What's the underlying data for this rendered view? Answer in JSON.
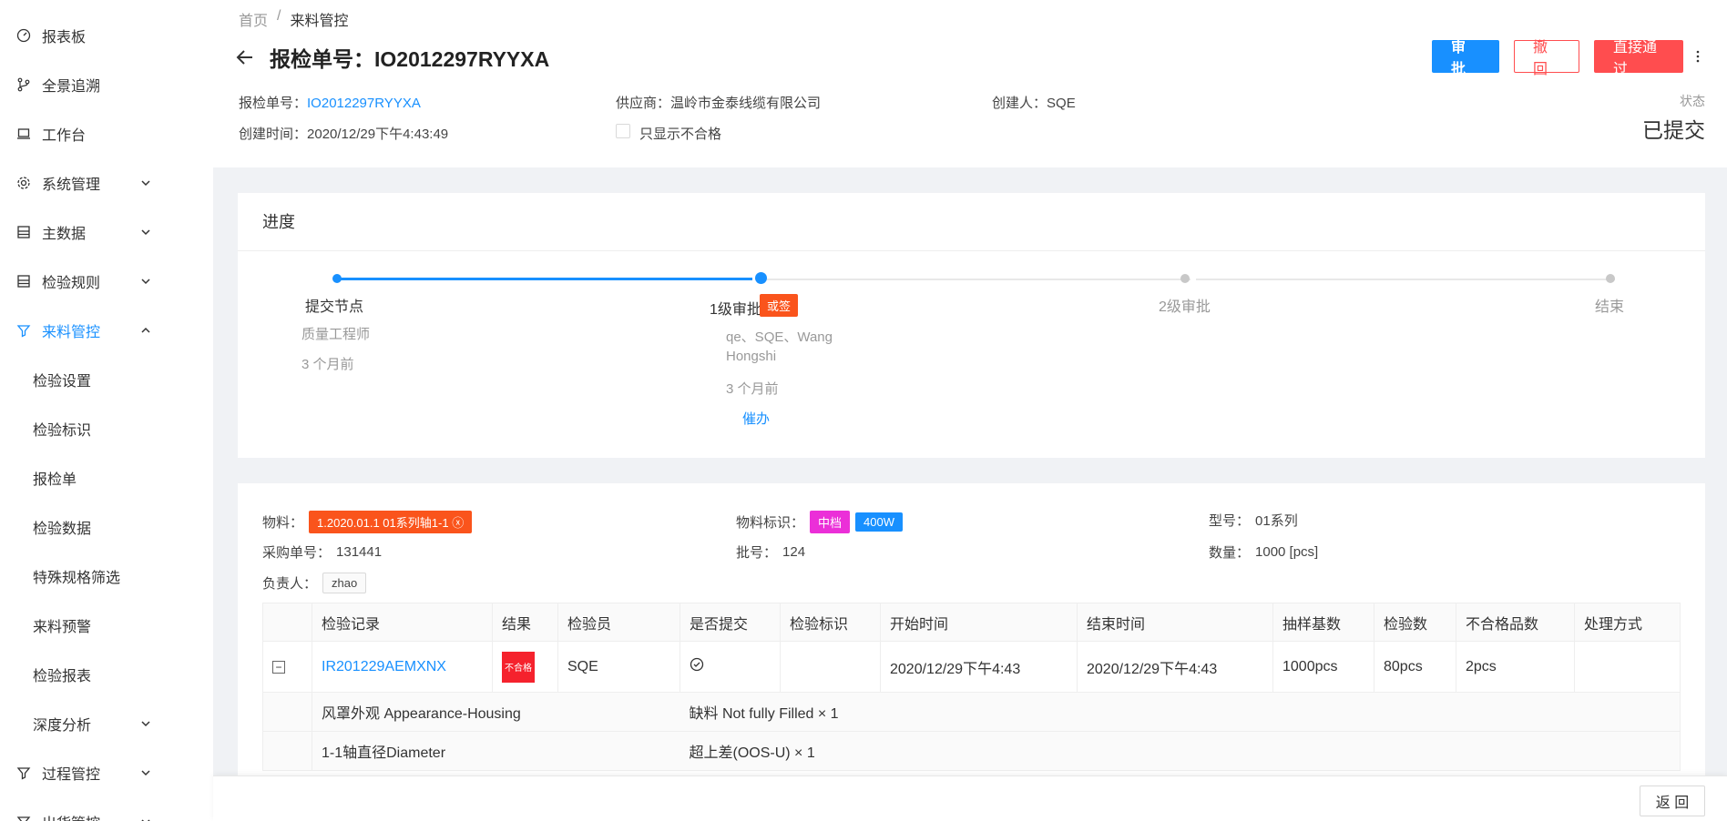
{
  "sidebar": {
    "items": [
      {
        "label": "报表板",
        "icon": "dashboard-icon"
      },
      {
        "label": "全景追溯",
        "icon": "branch-icon"
      },
      {
        "label": "工作台",
        "icon": "laptop-icon"
      },
      {
        "label": "系统管理",
        "icon": "gear-icon"
      },
      {
        "label": "主数据",
        "icon": "database-icon"
      },
      {
        "label": "检验规则",
        "icon": "database-icon"
      },
      {
        "label": "来料管控",
        "icon": "filter-icon"
      },
      {
        "label": "检验设置"
      },
      {
        "label": "检验标识"
      },
      {
        "label": "报检单"
      },
      {
        "label": "检验数据"
      },
      {
        "label": "特殊规格筛选"
      },
      {
        "label": "来料预警"
      },
      {
        "label": "检验报表"
      },
      {
        "label": "深度分析"
      },
      {
        "label": "过程管控",
        "icon": "filter-icon"
      },
      {
        "label": "出货管控",
        "icon": "filter-icon"
      }
    ]
  },
  "breadcrumb": {
    "home": "首页",
    "sep": "/",
    "current": "来料管控"
  },
  "header": {
    "title": "报检单号：IO2012297RYYXA",
    "actions": {
      "approve": "审 批",
      "revoke": "撤 回",
      "pass": "直接通过"
    },
    "fields": {
      "no_label": "报检单号：",
      "no_value": "IO2012297RYYXA",
      "supplier_label": "供应商：",
      "supplier_value": "温岭市金泰线缆有限公司",
      "creator_label": "创建人：",
      "creator_value": "SQE",
      "created_label": "创建时间：",
      "created_value": "2020/12/29下午4:43:49",
      "only_fail": "只显示不合格"
    },
    "status_label": "状态",
    "status_value": "已提交"
  },
  "progress": {
    "title": "进度",
    "steps": [
      {
        "label": "提交节点",
        "role": "质量工程师",
        "time": "3 个月前"
      },
      {
        "label": "1级审批",
        "badge": "或签",
        "people": "qe、SQE、Wang",
        "people2": "Hongshi",
        "time": "3 个月前",
        "action": "催办"
      },
      {
        "label": "2级审批"
      },
      {
        "label": "结束"
      }
    ],
    "colors": {
      "active": "#1890ff",
      "inactive": "#e8e8e8"
    }
  },
  "detail": {
    "material_label": "物料：",
    "material_value": "1.2020.01.1 01系列轴1-1",
    "mark_label": "物料标识：",
    "mark_tag1": "中档",
    "mark_tag2": "400W",
    "model_label": "型号：",
    "model_value": "01系列",
    "po_label": "采购单号：",
    "po_value": "131441",
    "batch_label": "批号：",
    "batch_value": "124",
    "qty_label": "数量：",
    "qty_value": "1000 [pcs]",
    "owner_label": "负责人：",
    "owner_value": "zhao"
  },
  "table": {
    "headers": [
      "检验记录",
      "结果",
      "检验员",
      "是否提交",
      "检验标识",
      "开始时间",
      "结束时间",
      "抽样基数",
      "检验数",
      "不合格品数",
      "处理方式"
    ],
    "row": {
      "record": "IR201229AEMXNX",
      "result": "不合格",
      "inspector": "SQE",
      "start": "2020/12/29下午4:43",
      "end": "2020/12/29下午4:43",
      "base": "1000pcs",
      "count": "80pcs",
      "fail": "2pcs",
      "method": ""
    },
    "defects": [
      {
        "item": "风罩外观 Appearance-Housing",
        "desc": "缺料 Not fully Filled × 1"
      },
      {
        "item": "1-1轴直径Diameter",
        "desc": "超上差(OOS-U) × 1"
      }
    ]
  },
  "footer": {
    "back": "返 回"
  }
}
